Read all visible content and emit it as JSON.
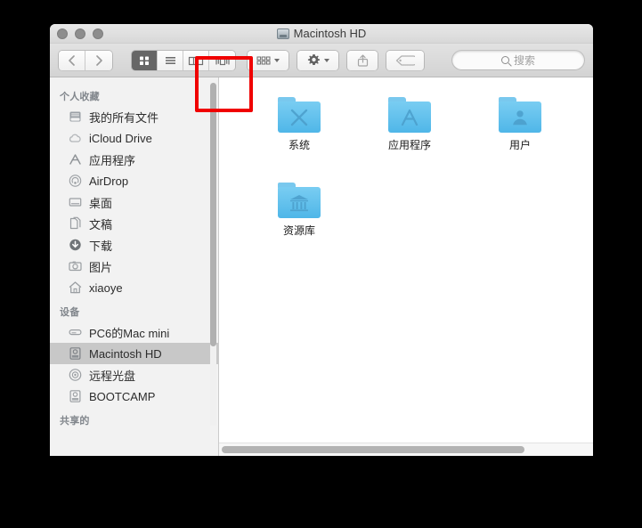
{
  "window": {
    "title": "Macintosh HD",
    "title_icon": "hard-disk-icon",
    "traffic_lights": [
      "close-button",
      "minimize-button",
      "zoom-button"
    ]
  },
  "toolbar": {
    "back_label": "‹",
    "forward_label": "›",
    "view_buttons": [
      {
        "name": "icon-view",
        "label": "▣",
        "active": true
      },
      {
        "name": "list-view",
        "label": "≡",
        "active": false
      },
      {
        "name": "column-view",
        "label": "⦀",
        "active": false
      },
      {
        "name": "coverflow-view",
        "label": "⧉",
        "active": false
      }
    ],
    "arrange_button": "arrange-icon",
    "action_button": "gear-icon",
    "share_button": "share-icon",
    "tag_button": "tag-icon",
    "search": {
      "placeholder": "搜索",
      "value": "",
      "icon": "search-icon"
    }
  },
  "sidebar": {
    "sections": [
      {
        "header": "个人收藏",
        "items": [
          {
            "label": "我的所有文件",
            "icon": "all-files-icon",
            "selected": false
          },
          {
            "label": "iCloud Drive",
            "icon": "cloud-icon",
            "selected": false
          },
          {
            "label": "应用程序",
            "icon": "applications-icon",
            "selected": false
          },
          {
            "label": "AirDrop",
            "icon": "airdrop-icon",
            "selected": false
          },
          {
            "label": "桌面",
            "icon": "desktop-icon",
            "selected": false
          },
          {
            "label": "文稿",
            "icon": "documents-icon",
            "selected": false
          },
          {
            "label": "下载",
            "icon": "downloads-icon",
            "selected": false
          },
          {
            "label": "图片",
            "icon": "pictures-icon",
            "selected": false
          },
          {
            "label": "xiaoye",
            "icon": "home-icon",
            "selected": false
          }
        ]
      },
      {
        "header": "设备",
        "items": [
          {
            "label": "PC6的Mac mini",
            "icon": "computer-icon",
            "selected": false
          },
          {
            "label": "Macintosh HD",
            "icon": "hard-disk-icon",
            "selected": true
          },
          {
            "label": "远程光盘",
            "icon": "optical-disc-icon",
            "selected": false
          },
          {
            "label": "BOOTCAMP",
            "icon": "hard-disk-icon",
            "selected": false
          }
        ]
      },
      {
        "header": "共享的",
        "items": []
      }
    ]
  },
  "content": {
    "items": [
      {
        "label": "系统",
        "glyph": "system-x-icon"
      },
      {
        "label": "应用程序",
        "glyph": "applications-a-icon"
      },
      {
        "label": "用户",
        "glyph": "users-person-icon"
      },
      {
        "label": "资源库",
        "glyph": "library-bank-icon"
      }
    ]
  },
  "annotation": {
    "highlight_color": "#f00000",
    "target": "icon-view-button"
  },
  "colors": {
    "folder_blue": "#4fb6e8",
    "folder_blue_light": "#79cdf2",
    "selection_gray": "#c8c8c8",
    "sidebar_bg": "#f2f2f2",
    "toolbar_bg": "#d8d8d8"
  }
}
